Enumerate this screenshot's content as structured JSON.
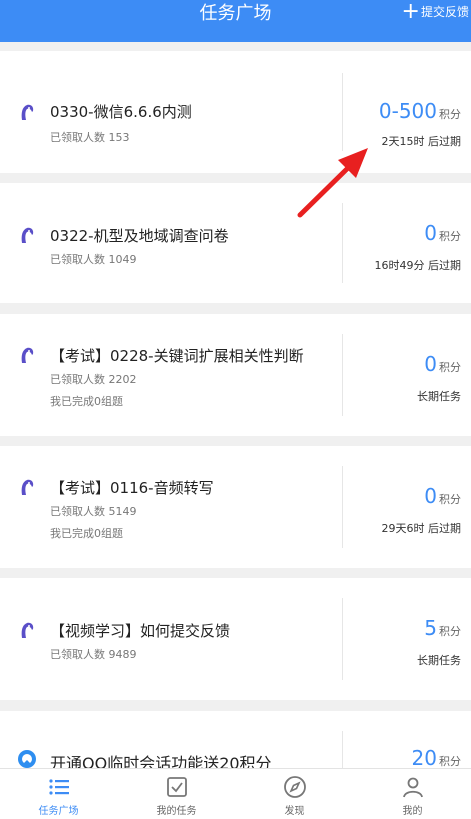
{
  "header": {
    "title": "任务广场",
    "submit_label": "提交反馈"
  },
  "tasks": [
    {
      "name": "0330-微信6.6.6内测",
      "count_text": "已领取人数 153",
      "extra": "",
      "points": "0-500",
      "points_unit": "积分",
      "expire": "2天15时 后过期",
      "icon": "penguin-icon"
    },
    {
      "name": "0322-机型及地域调查问卷",
      "count_text": "已领取人数 1049",
      "extra": "",
      "points": "0",
      "points_unit": "积分",
      "expire": "16时49分 后过期",
      "icon": "penguin-icon"
    },
    {
      "name": "【考试】0228-关键词扩展相关性判断",
      "count_text": "已领取人数 2202",
      "extra": "我已完成0组题",
      "points": "0",
      "points_unit": "积分",
      "expire": "长期任务",
      "icon": "penguin-icon"
    },
    {
      "name": "【考试】0116-音频转写",
      "count_text": "已领取人数 5149",
      "extra": "我已完成0组题",
      "points": "0",
      "points_unit": "积分",
      "expire": "29天6时 后过期",
      "icon": "penguin-icon"
    },
    {
      "name": "【视频学习】如何提交反馈",
      "count_text": "已领取人数 9489",
      "extra": "",
      "points": "5",
      "points_unit": "积分",
      "expire": "长期任务",
      "icon": "penguin-icon"
    },
    {
      "name": "开通QQ临时会话功能送20积分",
      "count_text": "",
      "extra": "",
      "points": "20",
      "points_unit": "积分",
      "expire": "",
      "icon": "qq-browser-icon"
    }
  ],
  "tabbar": [
    {
      "label": "任务广场",
      "active": true,
      "icon": "list-icon"
    },
    {
      "label": "我的任务",
      "active": false,
      "icon": "checkbox-icon"
    },
    {
      "label": "发现",
      "active": false,
      "icon": "compass-icon"
    },
    {
      "label": "我的",
      "active": false,
      "icon": "person-icon"
    }
  ],
  "colors": {
    "accent": "#3d8cf5",
    "annotation_arrow": "#e82020"
  }
}
